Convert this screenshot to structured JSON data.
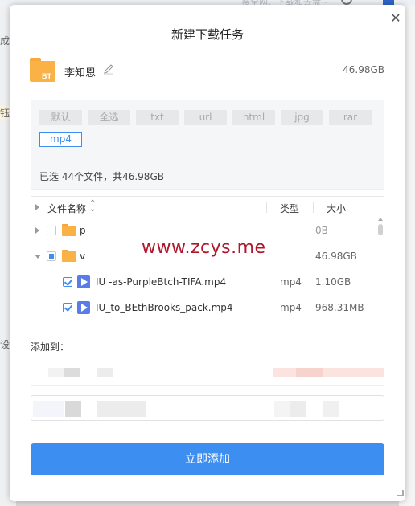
{
  "background": {
    "search_text": "搜全网、下载和去盘~",
    "left_chars": [
      "成",
      "钰",
      "设"
    ]
  },
  "dialog": {
    "title": "新建下载任务",
    "close_glyph": "✕",
    "task": {
      "icon_text": "BT",
      "name": "李知恩",
      "size": "46.98GB"
    },
    "filters": {
      "chips": [
        {
          "label": "默认",
          "active": false
        },
        {
          "label": "全选",
          "active": false
        },
        {
          "label": "txt",
          "active": false
        },
        {
          "label": "url",
          "active": false
        },
        {
          "label": "html",
          "active": false
        },
        {
          "label": "jpg",
          "active": false
        },
        {
          "label": "rar",
          "active": false
        },
        {
          "label": "mp4",
          "active": true
        }
      ],
      "summary": "已选 44个文件，共46.98GB"
    },
    "file_list": {
      "headers": {
        "name": "文件名称",
        "sort_glyph": "⌃⌄",
        "type": "类型",
        "size": "大小"
      },
      "rows": [
        {
          "kind": "folder",
          "expanded": false,
          "checked": "none",
          "name": "p",
          "type": "",
          "size": "0B"
        },
        {
          "kind": "folder",
          "expanded": true,
          "checked": "partial",
          "name": "v",
          "type": "",
          "size": "46.98GB"
        },
        {
          "kind": "file",
          "checked": "checked",
          "name": "IU -as-PurpleBtch-TIFA.mp4",
          "type": "mp4",
          "size": "1.10GB"
        },
        {
          "kind": "file",
          "checked": "checked",
          "name": "IU_to_BEthBrooks_pack.mp4",
          "type": "mp4",
          "size": "968.31MB"
        }
      ]
    },
    "watermark": "www.zcys.me",
    "add_to_label": "添加到：",
    "submit_label": "立即添加",
    "colors": {
      "accent": "#3c8ef1",
      "folder": "#fab246",
      "video": "#5b7be6",
      "watermark": "#b0152a"
    }
  }
}
